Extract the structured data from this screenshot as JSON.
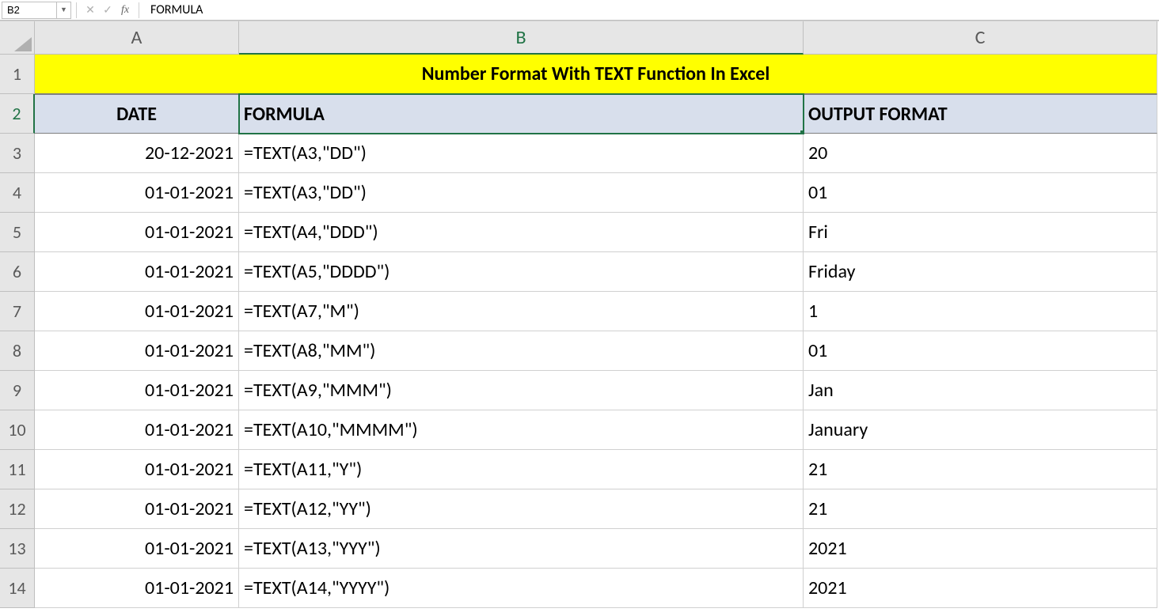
{
  "formula_bar": {
    "name_box": "B2",
    "content": "FORMULA"
  },
  "columns": [
    {
      "letter": "A",
      "width_class": "wA",
      "selected": false
    },
    {
      "letter": "B",
      "width_class": "wB",
      "selected": true
    },
    {
      "letter": "C",
      "width_class": "wC",
      "selected": false
    }
  ],
  "title": "Number Format With TEXT Function In Excel",
  "headers": {
    "A": "DATE",
    "B": "FORMULA",
    "C": "OUTPUT FORMAT"
  },
  "rows": [
    {
      "n": 3,
      "A": "20-12-2021",
      "B": "=TEXT(A3,\"DD\")",
      "C": "20"
    },
    {
      "n": 4,
      "A": "01-01-2021",
      "B": "=TEXT(A3,\"DD\")",
      "C": "01"
    },
    {
      "n": 5,
      "A": "01-01-2021",
      "B": "=TEXT(A4,\"DDD\")",
      "C": "Fri"
    },
    {
      "n": 6,
      "A": "01-01-2021",
      "B": "=TEXT(A5,\"DDDD\")",
      "C": "Friday"
    },
    {
      "n": 7,
      "A": "01-01-2021",
      "B": "=TEXT(A7,\"M\")",
      "C": "1"
    },
    {
      "n": 8,
      "A": "01-01-2021",
      "B": "=TEXT(A8,\"MM\")",
      "C": "01"
    },
    {
      "n": 9,
      "A": "01-01-2021",
      "B": "=TEXT(A9,\"MMM\")",
      "C": "Jan"
    },
    {
      "n": 10,
      "A": "01-01-2021",
      "B": "=TEXT(A10,\"MMMM\")",
      "C": "January"
    },
    {
      "n": 11,
      "A": "01-01-2021",
      "B": "=TEXT(A11,\"Y\")",
      "C": "21"
    },
    {
      "n": 12,
      "A": "01-01-2021",
      "B": "=TEXT(A12,\"YY\")",
      "C": "21"
    },
    {
      "n": 13,
      "A": "01-01-2021",
      "B": "=TEXT(A13,\"YYY\")",
      "C": "2021"
    },
    {
      "n": 14,
      "A": "01-01-2021",
      "B": "=TEXT(A14,\"YYYY\")",
      "C": "2021"
    }
  ],
  "selected_cell": "B2"
}
